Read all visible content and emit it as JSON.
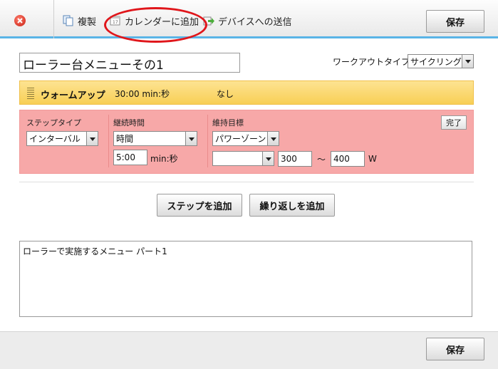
{
  "toolbar": {
    "close_icon": "close-icon",
    "copy_label": "複製",
    "add_calendar_label": "カレンダーに追加",
    "send_device_label": "デバイスへの送信",
    "save_label": "保存",
    "annotation_color": "#e0161b"
  },
  "workout": {
    "title": "ローラー台メニューその1",
    "type_label": "ワークアウトタイプ:",
    "type_value": "サイクリング"
  },
  "warmup": {
    "name": "ウォームアップ",
    "duration": "30:00 min:秒",
    "target": "なし"
  },
  "interval": {
    "step_type_label": "ステップタイプ",
    "step_type_value": "インターバル",
    "duration_label": "継続時間",
    "duration_type_value": "時間",
    "duration_value": "5:00",
    "duration_unit": "min:秒",
    "target_label": "維持目標",
    "target_type_value": "パワーゾーン",
    "zone_value": "",
    "low_value": "300",
    "range_sep": "〜",
    "high_value": "400",
    "unit": "W",
    "done_label": "完了"
  },
  "actions": {
    "add_step_label": "ステップを追加",
    "add_repeat_label": "繰り返しを追加"
  },
  "description": "ローラーで実施するメニュー パート1",
  "footer": {
    "save_label": "保存"
  },
  "colors": {
    "accent": "#5ab4e6",
    "warmup": "#f8cf55",
    "interval": "#f7a8a8"
  }
}
